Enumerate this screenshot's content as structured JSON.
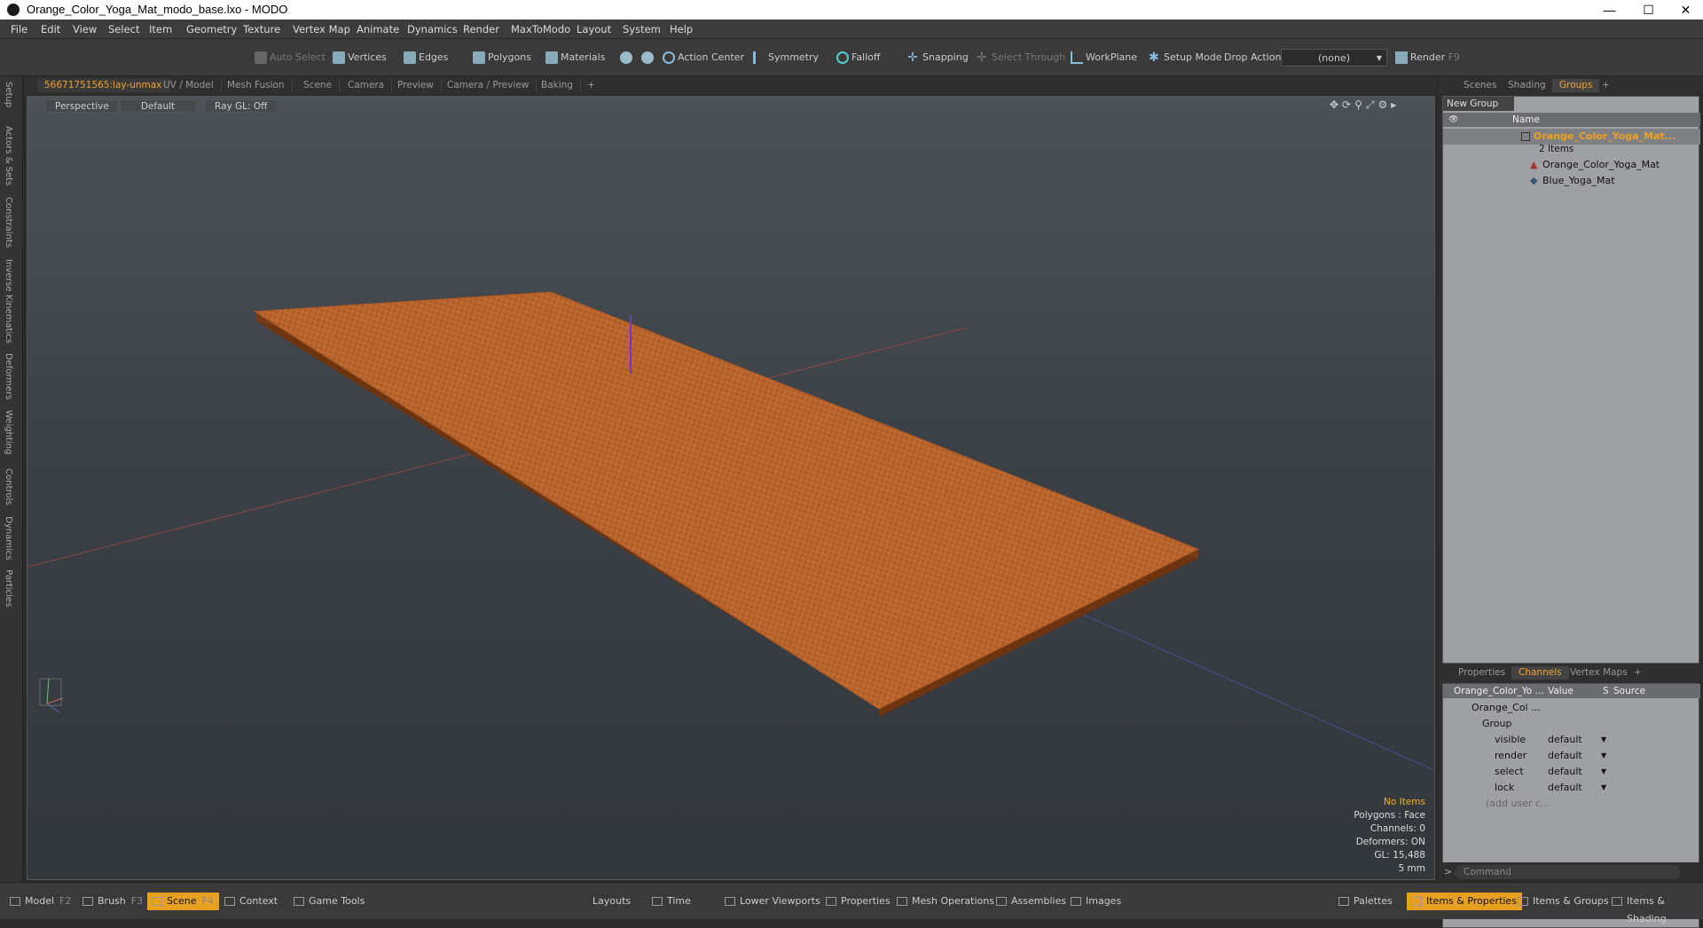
{
  "window": {
    "title": "Orange_Color_Yoga_Mat_modo_base.lxo - MODO",
    "minimize": "—",
    "maximize": "☐",
    "close": "✕"
  },
  "menu": [
    "File",
    "Edit",
    "View",
    "Select",
    "Item",
    "Geometry",
    "Texture",
    "Vertex Map",
    "Animate",
    "Dynamics",
    "Render",
    "MaxToModo",
    "Layout",
    "System",
    "Help"
  ],
  "toolbar": {
    "auto_select": "Auto Select",
    "vertices": "Vertices",
    "edges": "Edges",
    "polygons": "Polygons",
    "materials": "Materials",
    "action_center": "Action Center",
    "symmetry": "Symmetry",
    "falloff": "Falloff",
    "snapping": "Snapping",
    "select_through": "Select Through",
    "workplane": "WorkPlane",
    "setup_mode": "Setup Mode",
    "drop_action": "Drop Action",
    "drop_value": "(none)",
    "render": "Render",
    "render_key": "F9"
  },
  "left_tabs": [
    "Setup",
    "Actors & Sets",
    "Constraints",
    "Inverse Kinematics",
    "Deformers",
    "Weighting",
    "Controls",
    "Dynamics",
    "Particles"
  ],
  "viewport_tabs": [
    "56671751565:lay-unmax",
    "UV / Model",
    "Mesh Fusion",
    "Scene",
    "Camera",
    "Preview",
    "Camera / Preview",
    "Baking",
    "+"
  ],
  "viewport": {
    "perspective": "Perspective",
    "default": "Default",
    "raygl": "Ray GL: Off",
    "info": {
      "items": "No Items",
      "polygons": "Polygons : Face",
      "channels": "Channels: 0",
      "deformers": "Deformers: ON",
      "gl": "GL: 15,488",
      "unit": "5 mm"
    }
  },
  "right_tabs": [
    "Scenes",
    "Shading",
    "Groups",
    "+"
  ],
  "groups": {
    "new_group": "New Group",
    "name_col": "Name",
    "root": "Orange_Color_Yoga_Mat...",
    "count": "2 Items",
    "children": [
      "Orange_Color_Yoga_Mat",
      "Blue_Yoga_Mat"
    ]
  },
  "props_tabs": [
    "Properties",
    "Channels",
    "Vertex Maps",
    "+"
  ],
  "channels": {
    "col_name": "Orange_Color_Yo ...",
    "col_value": "Value",
    "col_s": "S",
    "col_source": "Source",
    "root": "Orange_Col ...",
    "group": "Group",
    "rows": [
      {
        "name": "visible",
        "value": "default"
      },
      {
        "name": "render",
        "value": "default"
      },
      {
        "name": "select",
        "value": "default"
      },
      {
        "name": "lock",
        "value": "default"
      }
    ],
    "add": "(add user c..."
  },
  "command": {
    "prompt": ">",
    "placeholder": "Command"
  },
  "bottom": {
    "model": "Model",
    "model_key": "F2",
    "brush": "Brush",
    "brush_key": "F3",
    "scene": "Scene",
    "scene_key": "F4",
    "context": "Context",
    "game_tools": "Game Tools",
    "layouts": "Layouts",
    "time": "Time",
    "lower_viewports": "Lower Viewports",
    "properties": "Properties",
    "mesh_ops": "Mesh Operations",
    "assemblies": "Assemblies",
    "images": "Images",
    "palettes": "Palettes",
    "items_props": "Items & Properties",
    "items_groups": "Items & Groups",
    "items_shading": "Items & Shading"
  },
  "colors": {
    "accent": "#f0a030",
    "mat": "#b8642c",
    "active_tab_bg": "#e8a020"
  }
}
